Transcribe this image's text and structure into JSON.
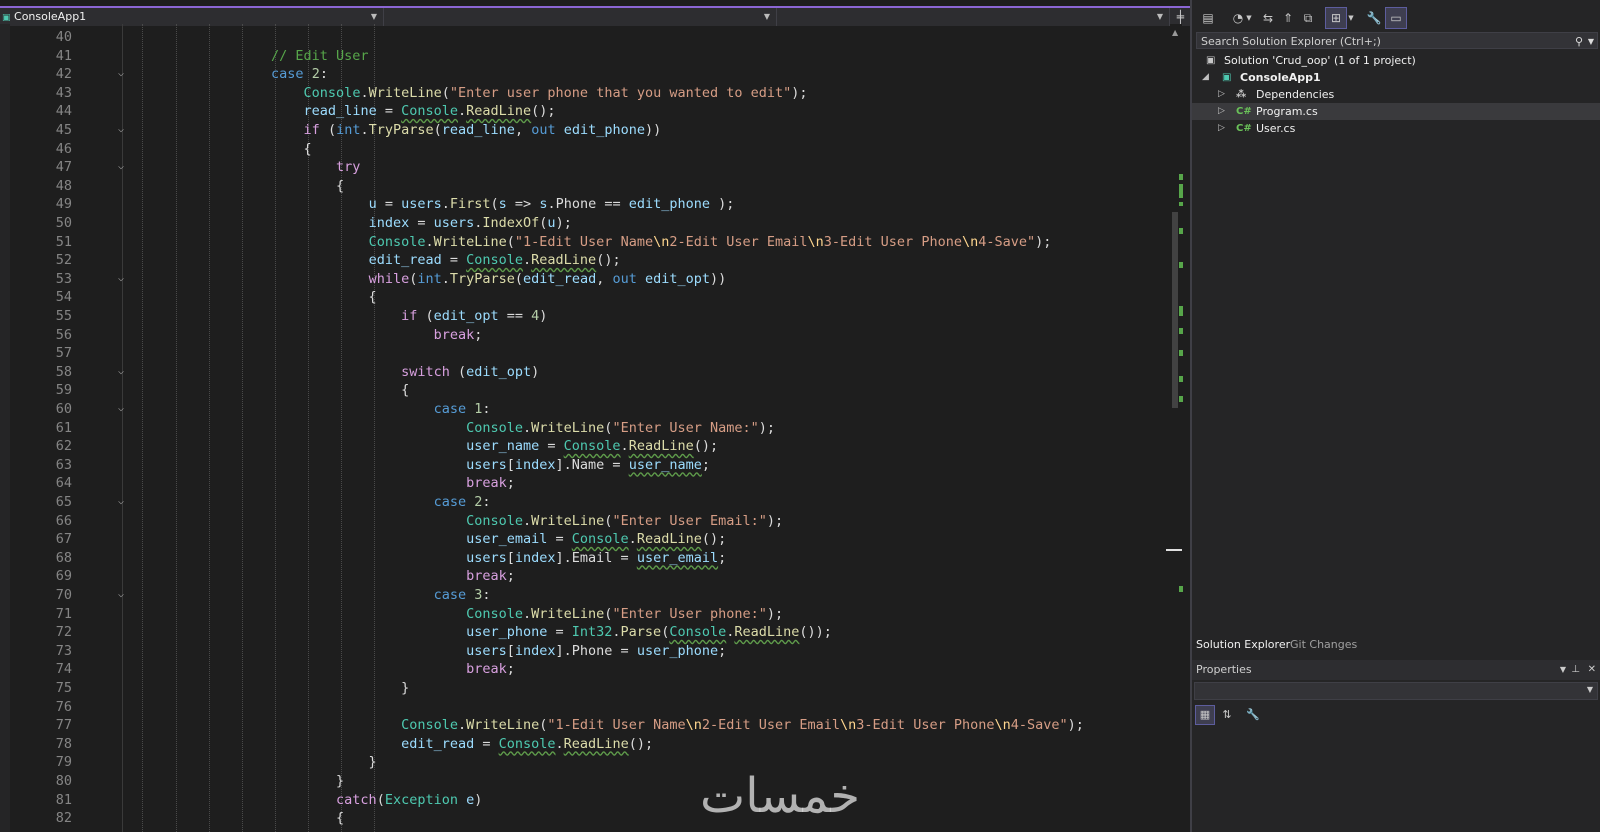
{
  "nav": {
    "project": "ConsoleApp1",
    "split_icon": "split-icon"
  },
  "code": {
    "lines": [
      {
        "n": "40",
        "t": ""
      },
      {
        "n": "41",
        "t": ""
      },
      {
        "n": "42",
        "t": ""
      },
      {
        "n": "43",
        "t": ""
      },
      {
        "n": "44",
        "t": ""
      },
      {
        "n": "45",
        "t": ""
      },
      {
        "n": "46",
        "t": ""
      },
      {
        "n": "47",
        "t": ""
      },
      {
        "n": "48",
        "t": ""
      },
      {
        "n": "49",
        "t": ""
      },
      {
        "n": "50",
        "t": ""
      },
      {
        "n": "51",
        "t": ""
      },
      {
        "n": "52",
        "t": ""
      },
      {
        "n": "53",
        "t": ""
      },
      {
        "n": "54",
        "t": ""
      },
      {
        "n": "55",
        "t": ""
      },
      {
        "n": "56",
        "t": ""
      },
      {
        "n": "57",
        "t": ""
      },
      {
        "n": "58",
        "t": ""
      },
      {
        "n": "59",
        "t": ""
      },
      {
        "n": "60",
        "t": ""
      },
      {
        "n": "61",
        "t": ""
      },
      {
        "n": "62",
        "t": ""
      },
      {
        "n": "63",
        "t": ""
      },
      {
        "n": "64",
        "t": ""
      },
      {
        "n": "65",
        "t": ""
      },
      {
        "n": "66",
        "t": ""
      },
      {
        "n": "67",
        "t": ""
      },
      {
        "n": "68",
        "t": ""
      },
      {
        "n": "69",
        "t": ""
      },
      {
        "n": "70",
        "t": ""
      },
      {
        "n": "71",
        "t": ""
      },
      {
        "n": "72",
        "t": ""
      },
      {
        "n": "73",
        "t": ""
      },
      {
        "n": "74",
        "t": ""
      },
      {
        "n": "75",
        "t": ""
      },
      {
        "n": "76",
        "t": ""
      },
      {
        "n": "77",
        "t": ""
      },
      {
        "n": "78",
        "t": ""
      },
      {
        "n": "79",
        "t": ""
      },
      {
        "n": "80",
        "t": ""
      },
      {
        "n": "81",
        "t": ""
      },
      {
        "n": "82",
        "t": ""
      }
    ],
    "source": [
      "",
      "        // Edit User",
      "        case 2:",
      "            Console.WriteLine(\"Enter user phone that you wanted to edit\");",
      "            read_line = Console.ReadLine();",
      "            if (int.TryParse(read_line, out edit_phone))",
      "            {",
      "                try",
      "                {",
      "                    u = users.First(s => s.Phone == edit_phone );",
      "                    index = users.IndexOf(u);",
      "                    Console.WriteLine(\"1-Edit User Name\\n2-Edit User Email\\n3-Edit User Phone\\n4-Save\");",
      "                    edit_read = Console.ReadLine();",
      "                    while(int.TryParse(edit_read, out edit_opt))",
      "                    {",
      "                        if (edit_opt == 4)",
      "                            break;",
      "",
      "                        switch (edit_opt)",
      "                        {",
      "                            case 1:",
      "                                Console.WriteLine(\"Enter User Name:\");",
      "                                user_name = Console.ReadLine();",
      "                                users[index].Name = user_name;",
      "                                break;",
      "                            case 2:",
      "                                Console.WriteLine(\"Enter User Email:\");",
      "                                user_email = Console.ReadLine();",
      "                                users[index].Email = user_email;",
      "                                break;",
      "                            case 3:",
      "                                Console.WriteLine(\"Enter User phone:\");",
      "                                user_phone = Int32.Parse(Console.ReadLine());",
      "                                users[index].Phone = user_phone;",
      "                                break;",
      "                        }",
      "",
      "                        Console.WriteLine(\"1-Edit User Name\\n2-Edit User Email\\n3-Edit User Phone\\n4-Save\");",
      "                        edit_read = Console.ReadLine();",
      "                    }",
      "                }",
      "                catch(Exception e)",
      "                {"
    ],
    "folds": [
      "42",
      "45",
      "47",
      "53",
      "58",
      "60",
      "65",
      "70"
    ]
  },
  "solution_explorer": {
    "search_placeholder": "Search Solution Explorer (Ctrl+;)",
    "solution": "Solution 'Crud_oop' (1 of 1 project)",
    "project": "ConsoleApp1",
    "items": [
      {
        "label": "Dependencies",
        "icon": "dependencies-icon"
      },
      {
        "label": "Program.cs",
        "icon": "csharp-file-icon",
        "selected": true
      },
      {
        "label": "User.cs",
        "icon": "csharp-file-icon"
      }
    ]
  },
  "tabs": {
    "solution_explorer": "Solution Explorer",
    "git_changes": "Git Changes"
  },
  "properties": {
    "title": "Properties"
  },
  "watermark": "خمسات",
  "colors": {
    "accent": "#8b66d4",
    "bg": "#1e1e1e",
    "panel": "#252526"
  }
}
